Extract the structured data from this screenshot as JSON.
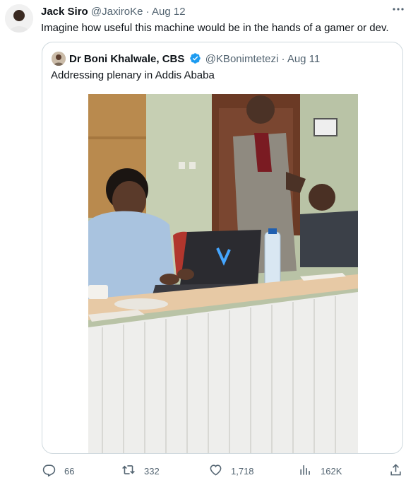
{
  "author": {
    "name": "Jack Siro",
    "handle": "@JaxiroKe",
    "sep": "·",
    "date": "Aug 12"
  },
  "tweet_text": "Imagine how useful this machine would be in the hands of a gamer or dev.",
  "quoted": {
    "name": "Dr Boni Khalwale, CBS",
    "handle": "@KBonimtetezi",
    "sep": "·",
    "date": "Aug 11",
    "text": "Addressing plenary in Addis Ababa"
  },
  "actions": {
    "replies": "66",
    "retweets": "332",
    "likes": "1,718",
    "views": "162K"
  },
  "icons": [
    "more-icon",
    "verified-icon",
    "reply-icon",
    "retweet-icon",
    "like-icon",
    "views-icon",
    "share-icon"
  ],
  "colors": {
    "verified": "#1d9bf0",
    "muted": "#536471",
    "text": "#0f1419",
    "border": "#cfd9de"
  }
}
